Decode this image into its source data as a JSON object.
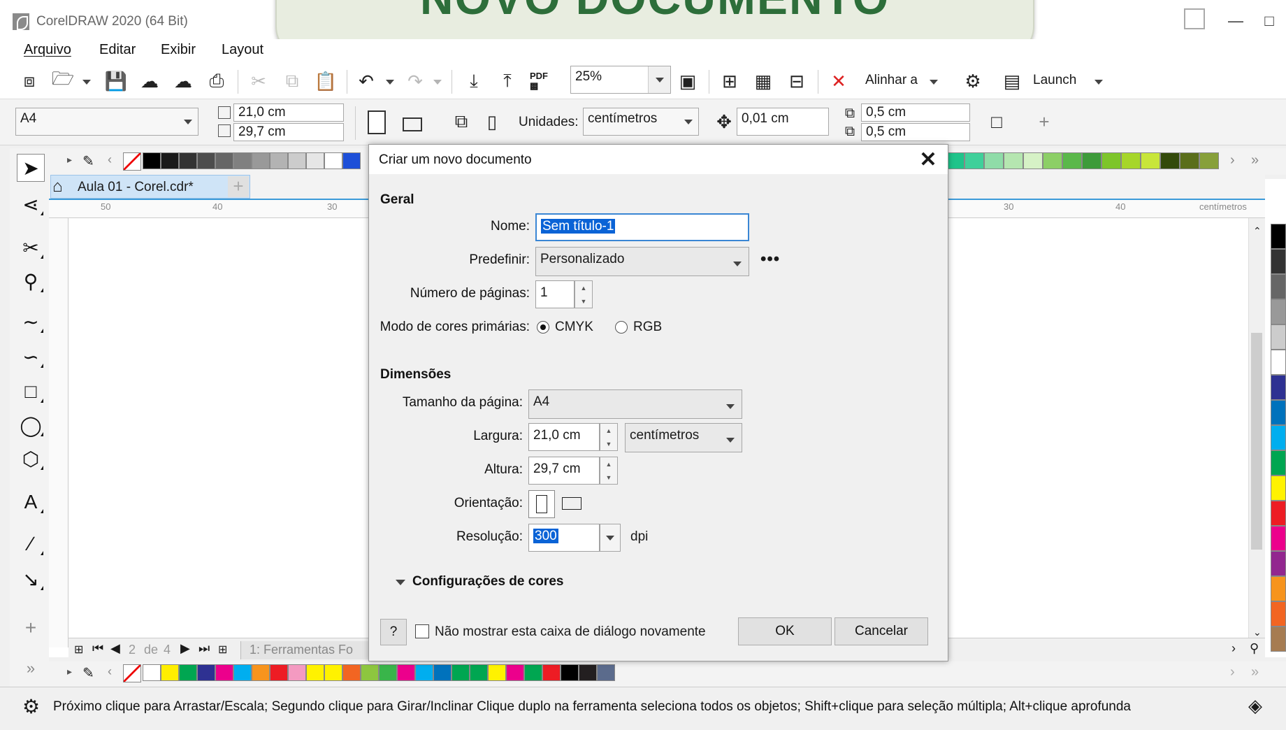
{
  "app": {
    "title": "CorelDRAW 2020 (64 Bit)"
  },
  "banner": {
    "text": "NOVO DOCUMENTO"
  },
  "menubar": {
    "items": [
      "Arquivo",
      "Editar",
      "Exibir",
      "Layout"
    ]
  },
  "toolbar": {
    "zoom": "25%",
    "align_label": "Alinhar a",
    "launch_label": "Launch",
    "pdf_label": "PDF"
  },
  "propbar": {
    "page_size": "A4",
    "width": "21,0 cm",
    "height": "29,7 cm",
    "units_label": "Unidades:",
    "units_value": "centímetros",
    "nudge": "0,01 cm",
    "dup_x": "0,5 cm",
    "dup_y": "0,5 cm"
  },
  "document": {
    "tab_title": "Aula 01 - Corel.cdr*",
    "ruler_h": [
      "50",
      "40",
      "30",
      "30",
      "40"
    ],
    "ruler_unit": "centímetros",
    "page_nav": {
      "current": "2",
      "of": "de",
      "total": "4",
      "page_tab": "1: Ferramentas Fo"
    }
  },
  "dialog": {
    "title": "Criar um novo documento",
    "close_icon": "close-icon",
    "general": {
      "title": "Geral",
      "name_label": "Nome:",
      "name_value": "Sem título-1",
      "preset_label": "Predefinir:",
      "preset_value": "Personalizado",
      "pages_label": "Número de páginas:",
      "pages_value": "1",
      "color_mode_label": "Modo de cores primárias:",
      "cmyk": "CMYK",
      "rgb": "RGB",
      "selected_mode": "CMYK"
    },
    "dimensions": {
      "title": "Dimensões",
      "page_size_label": "Tamanho da página:",
      "page_size_value": "A4",
      "width_label": "Largura:",
      "width_value": "21,0 cm",
      "unit_value": "centímetros",
      "height_label": "Altura:",
      "height_value": "29,7 cm",
      "orientation_label": "Orientação:",
      "resolution_label": "Resolução:",
      "resolution_value": "300",
      "resolution_unit": "dpi"
    },
    "color_settings": {
      "title": "Configurações de cores"
    },
    "footer": {
      "help_label": "?",
      "dont_show_label": "Não mostrar esta caixa de diálogo novamente",
      "ok_label": "OK",
      "cancel_label": "Cancelar"
    }
  },
  "status": {
    "text": "Próximo clique para Arrastar/Escala; Segundo clique para Girar/Inclinar Clique duplo na ferramenta seleciona todos os objetos; Shift+clique para seleção múltipla; Alt+clique aprofunda"
  },
  "colors": {
    "accent": "#3a86d4",
    "banner_bg": "#e8ede0",
    "banner_text": "#2d6e3a",
    "top_palette": [
      "#000000",
      "#1a1a1a",
      "#333333",
      "#4d4d4d",
      "#666666",
      "#808080",
      "#999999",
      "#b3b3b3",
      "#cccccc",
      "#e6e6e6",
      "#ffffff",
      "#1d4fd8"
    ],
    "top_palette_right": [
      "#1fc48a",
      "#3fd09a",
      "#8fdca8",
      "#b5e6b0",
      "#d6f2c6",
      "#8ccf66",
      "#5ab84a",
      "#3d9b3a",
      "#7dc52a",
      "#a6d62a",
      "#c8e63a",
      "#334a0a",
      "#5a6e1a",
      "#87a03a"
    ],
    "bottom_palette": [
      "#ffffff",
      "#ffee00",
      "#00a651",
      "#2e3192",
      "#ec008c",
      "#00aeef",
      "#f7941d",
      "#ed1c24",
      "#f49ac1",
      "#fff200",
      "#fff200",
      "#f26522",
      "#8dc63f",
      "#39b54a",
      "#ec008c",
      "#00aeef",
      "#0072bc",
      "#00a651",
      "#00a651",
      "#fff200",
      "#ec008c",
      "#00a651",
      "#ed1c24",
      "#000000",
      "#231f20",
      "#5b6b8c"
    ],
    "right_palette": [
      "#000000",
      "#333333",
      "#666666",
      "#999999",
      "#cccccc",
      "#ffffff",
      "#2e3192",
      "#0072bc",
      "#00aeef",
      "#00a651",
      "#fff200",
      "#ed1c24",
      "#ec008c",
      "#92278f",
      "#f7941d",
      "#f26522",
      "#a67c52"
    ]
  }
}
